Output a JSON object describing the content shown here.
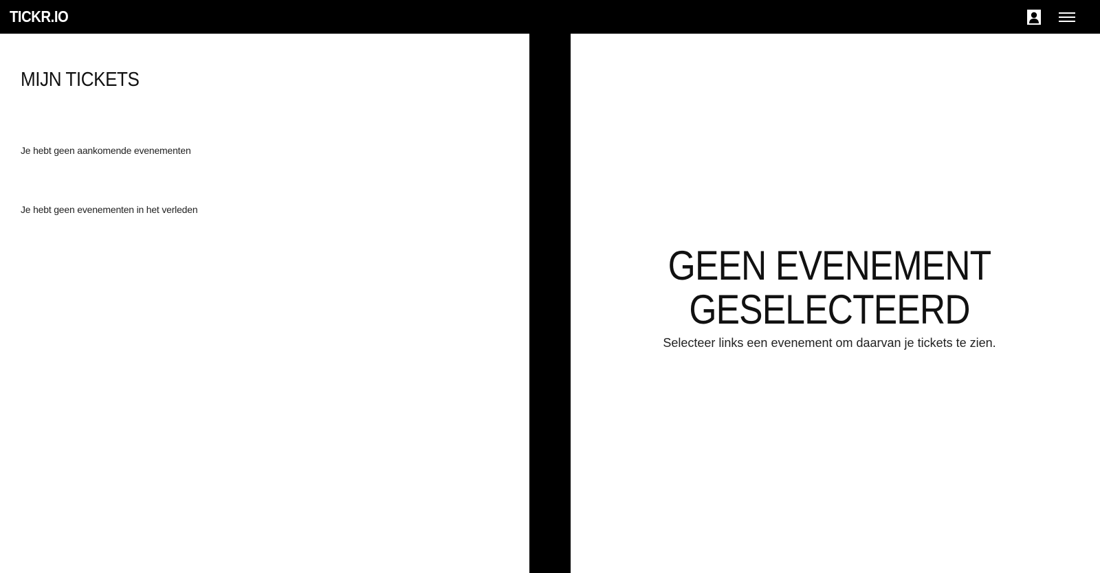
{
  "header": {
    "logo": "TICKR.IO",
    "account_icon": "user-icon",
    "menu_icon": "hamburger-menu-icon"
  },
  "tickets": {
    "title": "MIJN TICKETS",
    "upcoming_empty": "Je hebt geen aankomende evenementen",
    "past_empty": "Je hebt geen evenementen in het verleden"
  },
  "detail": {
    "title_line1": "GEEN EVENEMENT",
    "title_line2": "GESELECTEERD",
    "subtitle": "Selecteer links een evenement om daarvan je tickets te zien."
  },
  "colors": {
    "bar": "#000000",
    "background": "#ffffff",
    "text": "#111111"
  }
}
